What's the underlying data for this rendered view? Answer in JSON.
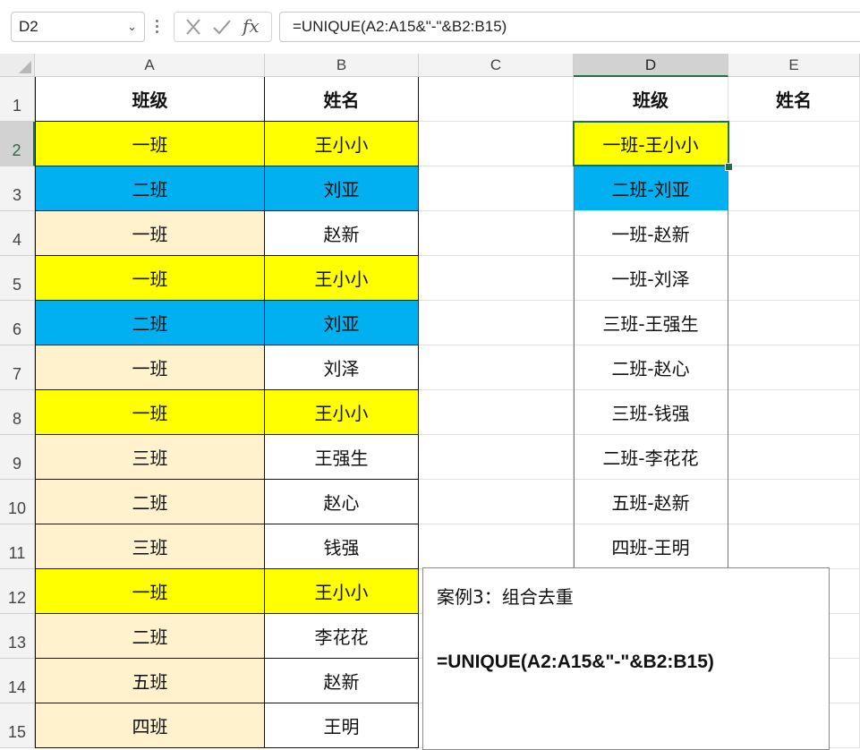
{
  "formula_bar": {
    "name_box": "D2",
    "formula": "=UNIQUE(A2:A15&\"-\"&B2:B15)",
    "fx_label": "fx"
  },
  "columns": [
    "A",
    "B",
    "C",
    "D",
    "E"
  ],
  "selected_column": "D",
  "rows": [
    "1",
    "2",
    "3",
    "4",
    "5",
    "6",
    "7",
    "8",
    "9",
    "10",
    "11",
    "12",
    "13",
    "14",
    "15"
  ],
  "selected_row": "2",
  "headers": {
    "a": "班级",
    "b": "姓名",
    "d": "班级",
    "e": "姓名"
  },
  "table": [
    {
      "cls": "一班",
      "name": "王小小"
    },
    {
      "cls": "二班",
      "name": "刘亚"
    },
    {
      "cls": "一班",
      "name": "赵新"
    },
    {
      "cls": "一班",
      "name": "王小小"
    },
    {
      "cls": "二班",
      "name": "刘亚"
    },
    {
      "cls": "一班",
      "name": "刘泽"
    },
    {
      "cls": "一班",
      "name": "王小小"
    },
    {
      "cls": "三班",
      "name": "王强生"
    },
    {
      "cls": "二班",
      "name": "赵心"
    },
    {
      "cls": "三班",
      "name": "钱强"
    },
    {
      "cls": "一班",
      "name": "王小小"
    },
    {
      "cls": "二班",
      "name": "李花花"
    },
    {
      "cls": "五班",
      "name": "赵新"
    },
    {
      "cls": "四班",
      "name": "王明"
    }
  ],
  "result": [
    "一班-王小小",
    "二班-刘亚",
    "一班-赵新",
    "一班-刘泽",
    "三班-王强生",
    "二班-赵心",
    "三班-钱强",
    "二班-李花花",
    "五班-赵新",
    "四班-王明"
  ],
  "colors": {
    "yellow": "#ffff00",
    "blue": "#00b0f0",
    "peach": "#fff2cc",
    "selection": "#1e7145"
  },
  "note": {
    "title": "案例3：组合去重",
    "formula": "=UNIQUE(A2:A15&\"-\"&B2:B15)"
  }
}
